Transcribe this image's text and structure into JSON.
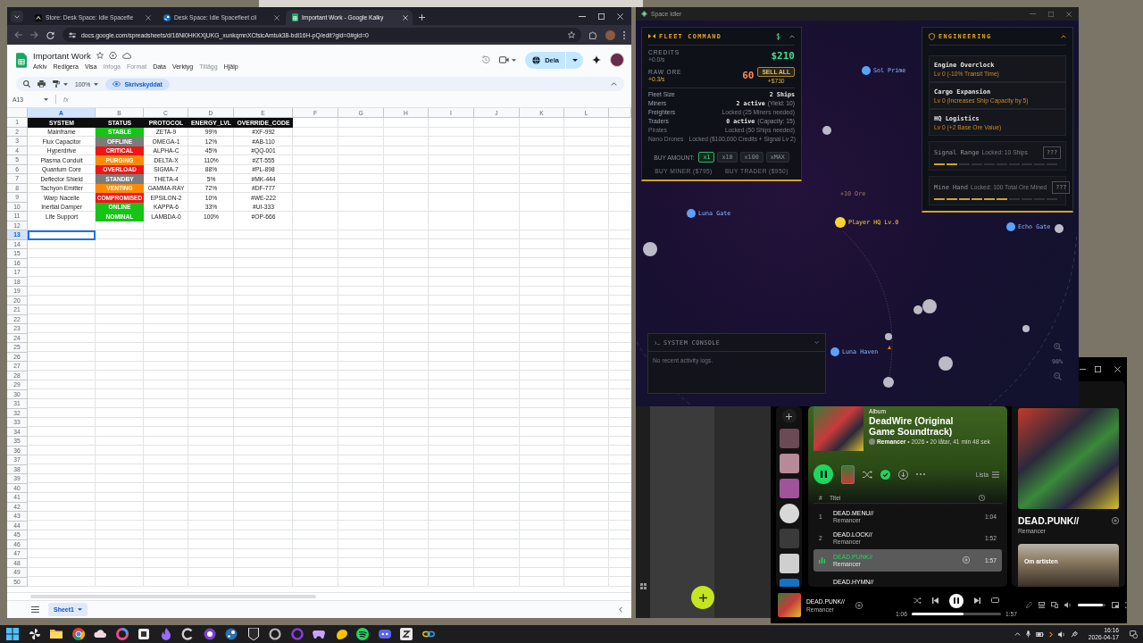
{
  "browser": {
    "tabs": [
      {
        "title": "Store: Desk Space: Idle Spacefle",
        "kind": "store",
        "selected": false
      },
      {
        "title": "Desk Space: Idle Spacefleet cli",
        "kind": "steam",
        "selected": false
      },
      {
        "title": "Important Work - Google Kalky",
        "kind": "sheets",
        "selected": true
      }
    ],
    "url": "docs.google.com/spreadsheets/d/16NI0HKKXjUKG_xunkqmnXCfsicAmtuk38-bdI16H-pQ/edit?gid=0#gid=0"
  },
  "sheets": {
    "title": "Important Work",
    "menu": [
      {
        "label": "Arkiv",
        "disabled": false
      },
      {
        "label": "Redigera",
        "disabled": false
      },
      {
        "label": "Visa",
        "disabled": false
      },
      {
        "label": "Infoga",
        "disabled": true
      },
      {
        "label": "Format",
        "disabled": true
      },
      {
        "label": "Data",
        "disabled": false
      },
      {
        "label": "Verktyg",
        "disabled": false
      },
      {
        "label": "Tillägg",
        "disabled": true
      },
      {
        "label": "Hjälp",
        "disabled": false
      }
    ],
    "share_button": "Dela",
    "zoom": "100%",
    "mode_chip": "Skrivskyddat",
    "name_box": "A13",
    "formula_label": "fx",
    "columns": [
      {
        "label": "A",
        "selected": true
      },
      {
        "label": "B",
        "selected": false
      },
      {
        "label": "C",
        "selected": false
      },
      {
        "label": "D",
        "selected": false
      },
      {
        "label": "E",
        "selected": false
      },
      {
        "label": "F",
        "selected": false
      },
      {
        "label": "G",
        "selected": false
      },
      {
        "label": "H",
        "selected": false
      },
      {
        "label": "I",
        "selected": false
      },
      {
        "label": "J",
        "selected": false
      },
      {
        "label": "K",
        "selected": false
      },
      {
        "label": "L",
        "selected": false
      }
    ],
    "row_numbers": [
      {
        "label": "1",
        "selected": false
      },
      {
        "label": "2",
        "selected": false
      },
      {
        "label": "3",
        "selected": false
      },
      {
        "label": "4",
        "selected": false
      },
      {
        "label": "5",
        "selected": false
      },
      {
        "label": "6",
        "selected": false
      },
      {
        "label": "7",
        "selected": false
      },
      {
        "label": "8",
        "selected": false
      },
      {
        "label": "9",
        "selected": false
      },
      {
        "label": "10",
        "selected": false
      },
      {
        "label": "11",
        "selected": false
      },
      {
        "label": "12",
        "selected": false
      },
      {
        "label": "13",
        "selected": true
      },
      {
        "label": "14",
        "selected": false
      },
      {
        "label": "15",
        "selected": false
      },
      {
        "label": "16",
        "selected": false
      },
      {
        "label": "17",
        "selected": false
      },
      {
        "label": "18",
        "selected": false
      },
      {
        "label": "19",
        "selected": false
      },
      {
        "label": "20",
        "selected": false
      },
      {
        "label": "21",
        "selected": false
      },
      {
        "label": "22",
        "selected": false
      },
      {
        "label": "23",
        "selected": false
      },
      {
        "label": "24",
        "selected": false
      },
      {
        "label": "25",
        "selected": false
      },
      {
        "label": "26",
        "selected": false
      },
      {
        "label": "27",
        "selected": false
      },
      {
        "label": "28",
        "selected": false
      },
      {
        "label": "29",
        "selected": false
      },
      {
        "label": "30",
        "selected": false
      },
      {
        "label": "31",
        "selected": false
      },
      {
        "label": "32",
        "selected": false
      },
      {
        "label": "33",
        "selected": false
      },
      {
        "label": "34",
        "selected": false
      },
      {
        "label": "35",
        "selected": false
      },
      {
        "label": "36",
        "selected": false
      },
      {
        "label": "37",
        "selected": false
      },
      {
        "label": "38",
        "selected": false
      },
      {
        "label": "39",
        "selected": false
      },
      {
        "label": "40",
        "selected": false
      },
      {
        "label": "41",
        "selected": false
      },
      {
        "label": "42",
        "selected": false
      },
      {
        "label": "43",
        "selected": false
      },
      {
        "label": "44",
        "selected": false
      },
      {
        "label": "45",
        "selected": false
      },
      {
        "label": "46",
        "selected": false
      },
      {
        "label": "47",
        "selected": false
      },
      {
        "label": "48",
        "selected": false
      },
      {
        "label": "49",
        "selected": false
      },
      {
        "label": "50",
        "selected": false
      }
    ],
    "header": [
      "SYSTEM",
      "STATUS",
      "PROTOCOL",
      "ENERGY_LVL",
      "OVERRIDE_CODE"
    ],
    "rows": [
      {
        "system": "Mainframe",
        "status": "STABLE",
        "color": "#16c416",
        "protocol": "ZETA-9",
        "energy": "99%",
        "code": "#XF-992"
      },
      {
        "system": "Flux Capacitor",
        "status": "OFFLINE",
        "color": "#7b7b7b",
        "protocol": "OMEGA-1",
        "energy": "12%",
        "code": "#AB-110"
      },
      {
        "system": "Hyperdrive",
        "status": "CRITICAL",
        "color": "#f01414",
        "protocol": "ALPHA-C",
        "energy": "45%",
        "code": "#QQ-001"
      },
      {
        "system": "Plasma Conduit",
        "status": "PURGING",
        "color": "#ff8a00",
        "protocol": "DELTA-X",
        "energy": "110%",
        "code": "#ZT-555"
      },
      {
        "system": "Quantum Core",
        "status": "OVERLOAD",
        "color": "#f01414",
        "protocol": "SIGMA-7",
        "energy": "88%",
        "code": "#PL-898"
      },
      {
        "system": "Deflector Shield",
        "status": "STANDBY",
        "color": "#7b7b7b",
        "protocol": "THETA-4",
        "energy": "5%",
        "code": "#MK-444"
      },
      {
        "system": "Tachyon Emitter",
        "status": "VENTING",
        "color": "#ff8a00",
        "protocol": "GAMMA-RAY",
        "energy": "72%",
        "code": "#DF-777"
      },
      {
        "system": "Warp Nacelle",
        "status": "COMPROMISED",
        "color": "#f01414",
        "protocol": "EPSILON-2",
        "energy": "10%",
        "code": "#WE-222"
      },
      {
        "system": "Inertial Damper",
        "status": "ONLINE",
        "color": "#16c416",
        "protocol": "KAPPA-6",
        "energy": "33%",
        "code": "#UI-333"
      },
      {
        "system": "Life Support",
        "status": "NOMINAL",
        "color": "#16c416",
        "protocol": "LAMBDA-0",
        "energy": "100%",
        "code": "#OP-666"
      }
    ],
    "sheet_tabs": [
      {
        "label": "Sheet1",
        "selected": true
      }
    ]
  },
  "space_idler": {
    "title": "Space Idler",
    "fleet": {
      "title": "FLEET COMMAND",
      "credits": {
        "label": "CREDITS",
        "rate": "+0.0/s",
        "value": "$210"
      },
      "ore": {
        "label": "RAW ORE",
        "rate": "+0.3/s",
        "value": "60",
        "sell": "SELL ALL",
        "sell_value": "+$730"
      },
      "stats": [
        {
          "label": "Fleet Size",
          "kind": "count",
          "value": "2 Ships",
          "disabled": false
        },
        {
          "label": "Miners",
          "kind": "count",
          "value": "2 active",
          "note": "(Yield: 10)",
          "disabled": false
        },
        {
          "label": "Freighters",
          "kind": "locked",
          "value": "Locked (25 Miners needed)",
          "disabled": false
        },
        {
          "label": "Traders",
          "kind": "count",
          "value": "0 active",
          "note": "(Capacity: 15)",
          "disabled": false
        },
        {
          "label": "Pirates",
          "kind": "locked",
          "value": "Locked (50 Ships needed)",
          "disabled": true
        },
        {
          "label": "Nano Drones",
          "kind": "locked",
          "value": "Locked ($100,000 Credits + Signal Lv 2)",
          "disabled": true
        }
      ],
      "buy_label": "BUY AMOUNT:",
      "amounts": [
        {
          "label": "x1",
          "selected": true
        },
        {
          "label": "x10",
          "selected": false
        },
        {
          "label": "x100",
          "selected": false
        },
        {
          "label": "xMAX",
          "selected": false
        }
      ],
      "actions": [
        {
          "label": "BUY MINER ($795)",
          "disabled": true
        },
        {
          "label": "BUY TRADER ($950)",
          "disabled": true
        }
      ]
    },
    "engineering": {
      "title": "ENGINEERING",
      "upgrades": [
        {
          "name": "Engine Overclock",
          "detail": "Lv 0 (-10% Transit Time)"
        },
        {
          "name": "Cargo Expansion",
          "detail": "Lv 0 (Increases Ship Capacity by 5)"
        },
        {
          "name": "HQ Logistics",
          "detail": "Lv 0 (+2 Base Ore Value)"
        }
      ],
      "unlocks": [
        {
          "name": "Signal Range",
          "requirement": "Locked: 10 Ships",
          "button": "???",
          "level": 0.2
        },
        {
          "name": "Mine Hand",
          "requirement": "Locked: 100 Total Ore Mined",
          "button": "???",
          "level": 0.6
        }
      ]
    },
    "map": {
      "bodies": [
        {
          "kind": "planet",
          "name": "Sol Prime",
          "color": "#5aa2ff"
        },
        {
          "kind": "planet",
          "name": "Luna Gate",
          "color": "#5aa2ff"
        },
        {
          "kind": "base",
          "name": "Player HQ Lv.0",
          "color": "#ffd52e"
        },
        {
          "kind": "planet",
          "name": "Echo Gate",
          "color": "#5aa2ff"
        },
        {
          "kind": "planet",
          "name": "Luna Haven",
          "color": "#5aa2ff"
        }
      ],
      "floating_text": "+10 Ore",
      "zoom": "98%"
    },
    "console": {
      "title": "SYSTEM CONSOLE",
      "message": "No recent activity logs."
    }
  },
  "spotify": {
    "album": {
      "type": "Album",
      "title": "DeadWire (Original Game Soundtrack)",
      "artist": "Remancer",
      "meta": "• 2026 • 20 låtar, 41 min 48 sek",
      "saved": true
    },
    "view_label": "Lista",
    "columns": [
      "#",
      "Titel"
    ],
    "tracks": [
      {
        "number": "1",
        "title": "DEAD.MENU//",
        "artist": "Remancer",
        "duration": "1:04",
        "selected": false,
        "playing": false
      },
      {
        "number": "2",
        "title": "DEAD.LOCK//",
        "artist": "Remancer",
        "duration": "1:52",
        "selected": false,
        "playing": false
      },
      {
        "title": "DEAD.PUNK//",
        "artist": "Remancer",
        "duration": "1:57",
        "selected": true,
        "playing": true
      },
      {
        "title": "DEAD.HYMN//",
        "selected": false,
        "playing": false
      }
    ],
    "now_playing_panel": {
      "title": "DEAD.PUNK//",
      "artist": "Remancer",
      "about": "Om artisten"
    },
    "player": {
      "title": "DEAD.PUNK//",
      "artist": "Remancer",
      "elapsed": "1:06",
      "duration": "1:57",
      "playing": true,
      "progress": {
        "level": 0.58
      },
      "volume": {
        "level": 0.9
      }
    }
  },
  "taskbar": {
    "time": "16:16",
    "date": "2026-04-17"
  }
}
